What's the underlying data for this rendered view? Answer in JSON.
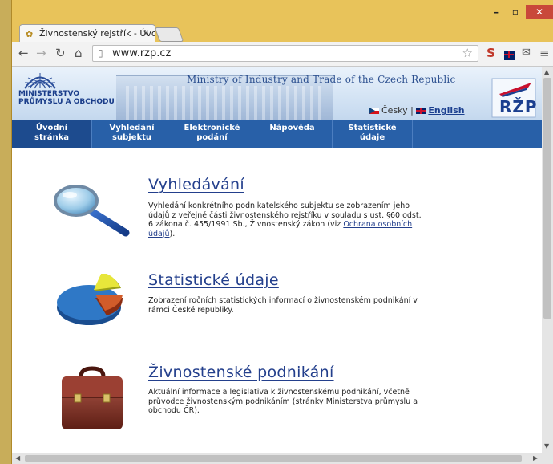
{
  "browser": {
    "tab_title": "Živnostenský rejstřík - Úvo",
    "tab_close": "×",
    "url": "www.rzp.cz",
    "colors": {
      "frame": "#e8c35a",
      "close": "#c9483a"
    },
    "icons": [
      "back-icon",
      "forward-icon",
      "reload-icon",
      "home-icon",
      "page-icon",
      "star-icon",
      "extension-icon",
      "uk-flag-icon",
      "mail-icon",
      "menu-icon"
    ]
  },
  "header": {
    "logo_line1": "MINISTERSTVO",
    "logo_line2": "PRŮMYSLU A OBCHODU",
    "ministry_title": "Ministry of Industry and Trade of the Czech Republic",
    "lang_cz": "Česky",
    "lang_sep": "|",
    "lang_en": "English",
    "brand": "RŽP"
  },
  "nav": {
    "items": [
      {
        "line1": "Úvodní",
        "line2": "stránka"
      },
      {
        "line1": "Vyhledání",
        "line2": "subjektu"
      },
      {
        "line1": "Elektronické",
        "line2": "podání"
      },
      {
        "line1": "Nápověda",
        "line2": ""
      },
      {
        "line1": "Statistické",
        "line2": "údaje"
      }
    ],
    "colors": {
      "bar": "#2860a8",
      "active": "#1d4b8e"
    }
  },
  "sections": [
    {
      "title": "Vyhledávání",
      "desc_pre": "Vyhledání konkrétního podnikatelského subjektu se zobrazením jeho údajů z veřejné části živnostenského rejstříku v souladu s ust. §60 odst. 6 zákona č. 455/1991 Sb., Živnostenský zákon (viz ",
      "desc_link": "Ochrana osobních údajů",
      "desc_post": ")."
    },
    {
      "title": "Statistické údaje",
      "desc": "Zobrazení ročních statistických informací o živnostenském podnikání v rámci České republiky."
    },
    {
      "title": "Živnostenské podnikání",
      "desc": "Aktuální informace a legislativa k živnostenskému podnikání, včetně průvodce živnostenským podnikáním (stránky Ministerstva průmyslu a obchodu ČR)."
    }
  ]
}
